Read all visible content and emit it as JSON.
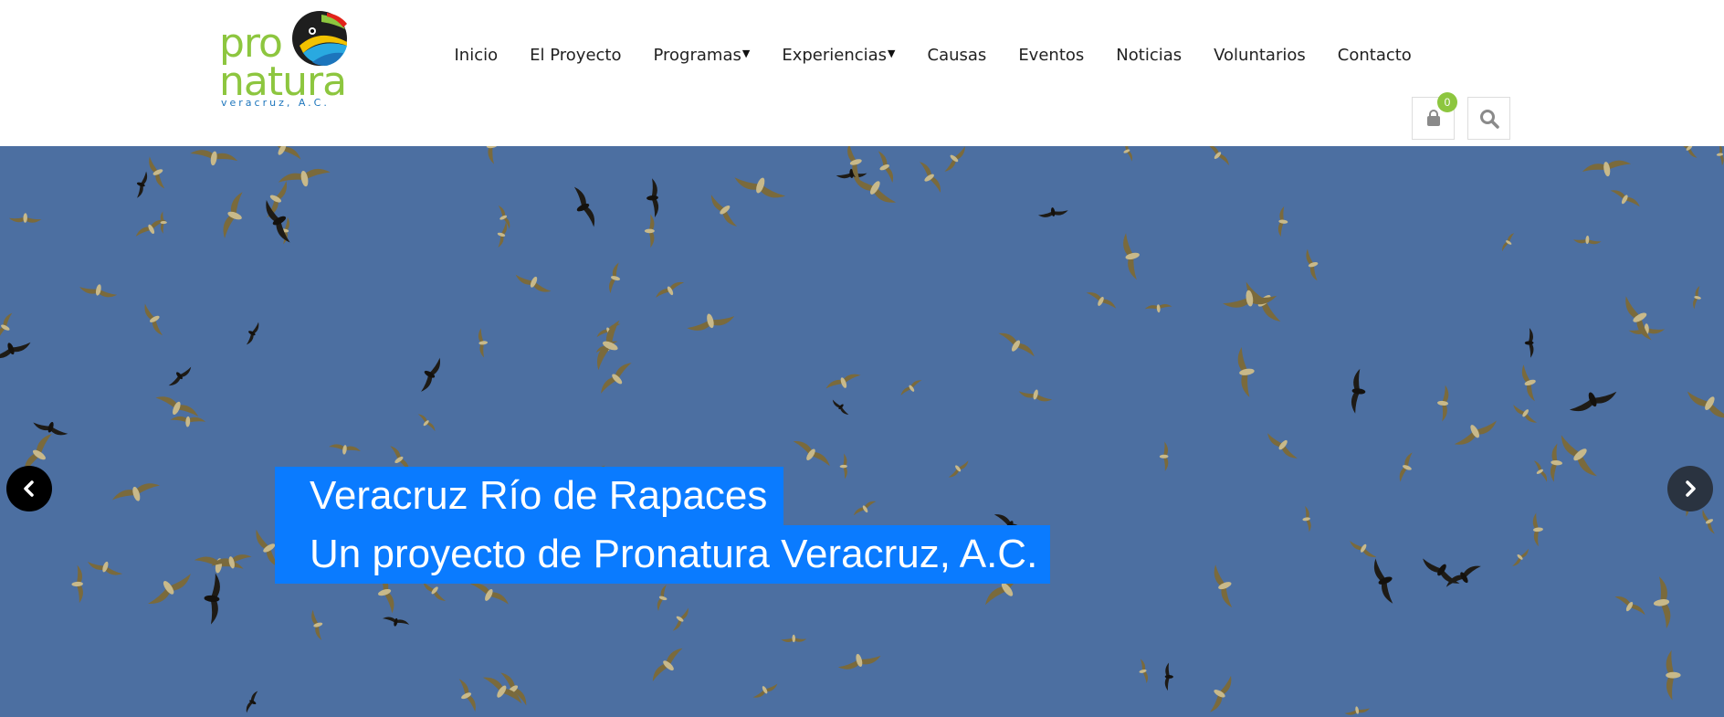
{
  "logo": {
    "line1": "pro",
    "line2": "natura",
    "tagline": "veracruz, A.C."
  },
  "nav": {
    "items": [
      {
        "label": "Inicio",
        "dropdown": false
      },
      {
        "label": "El Proyecto",
        "dropdown": false
      },
      {
        "label": "Programas",
        "dropdown": true
      },
      {
        "label": "Experiencias",
        "dropdown": true
      },
      {
        "label": "Causas",
        "dropdown": false
      },
      {
        "label": "Eventos",
        "dropdown": false
      },
      {
        "label": "Noticias",
        "dropdown": false
      },
      {
        "label": "Voluntarios",
        "dropdown": false
      },
      {
        "label": "Contacto",
        "dropdown": false
      }
    ]
  },
  "tools": {
    "cart_count": "0",
    "cart_icon": "shopping-bag-icon",
    "search_icon": "search-icon"
  },
  "hero": {
    "title": "Veracruz Río de Rapaces",
    "subtitle": "Un proyecto de Pronatura Veracruz, A.C.",
    "prev_icon": "chevron-left-icon",
    "next_icon": "chevron-right-icon"
  },
  "colors": {
    "brand_green": "#8dc63f",
    "brand_blue": "#1c75bc",
    "caption_bg": "#0a7bff",
    "sky": "#4c6fa1"
  }
}
